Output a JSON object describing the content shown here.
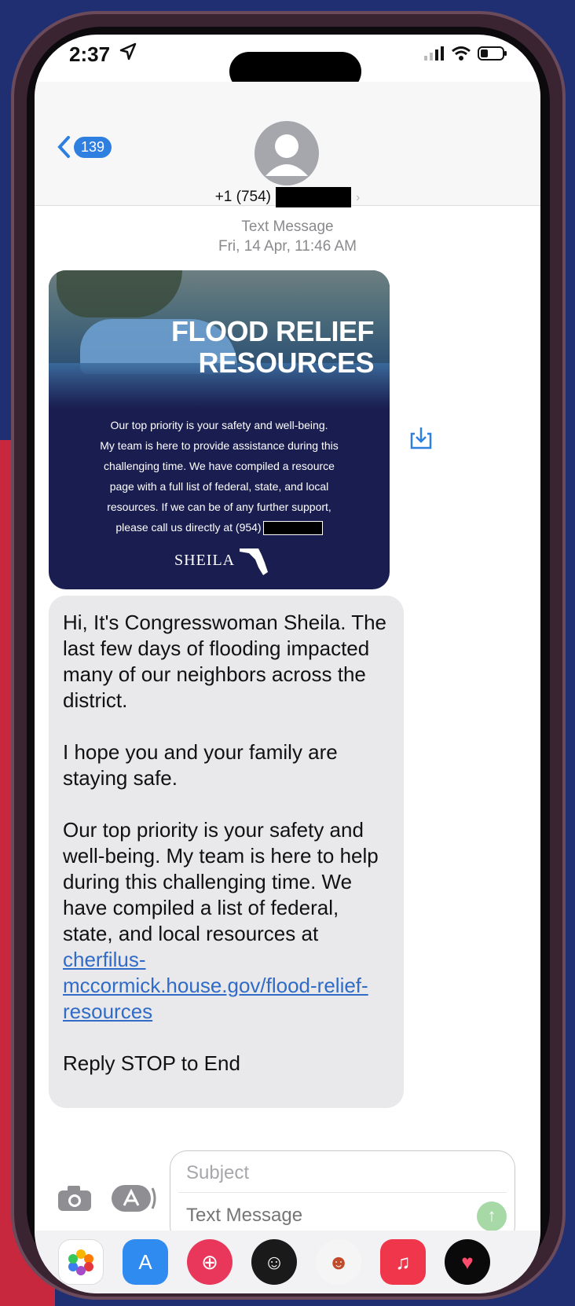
{
  "status": {
    "time": "2:37",
    "icons": [
      "location-arrow-icon",
      "signal-icon",
      "wifi-icon",
      "battery-icon"
    ]
  },
  "header": {
    "back_count": "139",
    "contact_prefix": "+1 (754)"
  },
  "thread": {
    "service": "Text Message",
    "timestamp": "Fri, 14 Apr, 11:46 AM"
  },
  "image_message": {
    "title_line1": "FLOOD RELIEF",
    "title_line2": "RESOURCES",
    "body_line1": "Our top priority is your safety and well-being.",
    "body_line2": "My team is here to provide assistance during this",
    "body_line3": "challenging time. We have compiled a resource",
    "body_line4": "page with a full list of federal, state, and local",
    "body_line5": "resources. If we can be of any further support,",
    "body_line6": "please call us directly at (954)",
    "logo_text": "SHEILA"
  },
  "text_message": {
    "para1": "Hi, It's Congresswoman Sheila. The last few days of flooding impacted many of our neighbors across the district.",
    "para2": "I hope you and your family are staying safe.",
    "para3_text": "Our top priority is your safety and well-being. My team is here to help during this challenging time. We have compiled a list of federal, state, and local resources at ",
    "para3_link": "cherfilus-mccormick.house.gov/flood-relief-resources",
    "para4": "Reply STOP to End"
  },
  "compose": {
    "subject_placeholder": "Subject",
    "message_placeholder": "Text Message"
  },
  "app_strip": [
    {
      "name": "photos-app-icon",
      "color": "#ffffff"
    },
    {
      "name": "app-store-icon",
      "color": "#2f8bf0"
    },
    {
      "name": "search-images-icon",
      "color": "#e8375b"
    },
    {
      "name": "memoji-icon",
      "color": "#1a1a1a"
    },
    {
      "name": "animoji-icon",
      "color": "#f5f5f5"
    },
    {
      "name": "music-icon",
      "color": "#f0364a"
    },
    {
      "name": "digital-touch-icon",
      "color": "#0a0a0a"
    }
  ],
  "colors": {
    "accent_blue": "#2f7fe0",
    "bubble_gray": "#e9e9eb",
    "link_blue": "#2f6bc7",
    "flyer_navy": "#1a1d4f"
  }
}
